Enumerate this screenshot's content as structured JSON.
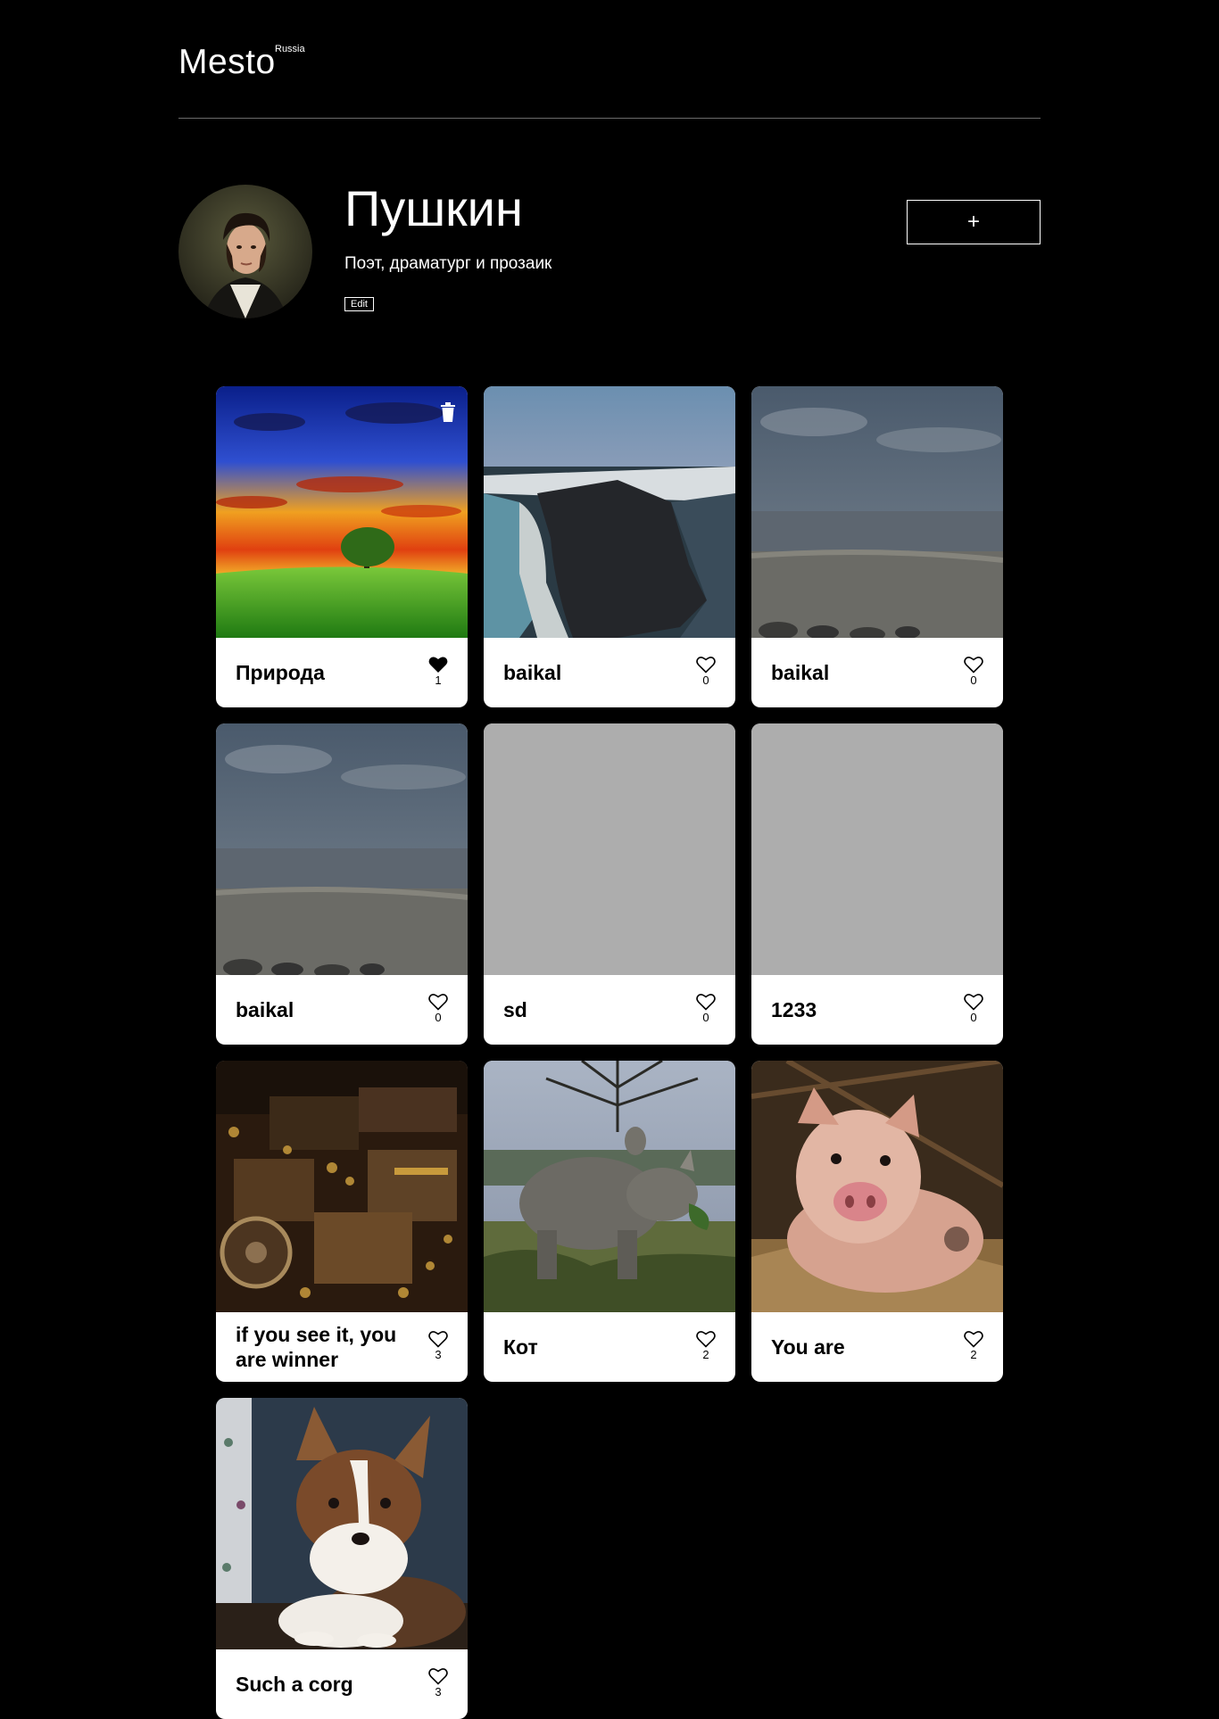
{
  "header": {
    "logo": "Mesto",
    "logo_sup": "Russia"
  },
  "profile": {
    "name": "Пушкин",
    "about": "Поэт, драматург и прозаик",
    "edit_label": "Edit",
    "add_label": "+"
  },
  "cards": [
    {
      "title": "Природа",
      "likes": "1",
      "liked": true,
      "deletable": true,
      "image": "sunset-tree"
    },
    {
      "title": "baikal",
      "likes": "0",
      "liked": false,
      "deletable": false,
      "image": "cliff-shore"
    },
    {
      "title": "baikal",
      "likes": "0",
      "liked": false,
      "deletable": false,
      "image": "grey-beach"
    },
    {
      "title": "baikal",
      "likes": "0",
      "liked": false,
      "deletable": false,
      "image": "grey-beach"
    },
    {
      "title": "sd",
      "likes": "0",
      "liked": false,
      "deletable": false,
      "image": "placeholder"
    },
    {
      "title": "1233",
      "likes": "0",
      "liked": false,
      "deletable": false,
      "image": "placeholder"
    },
    {
      "title": "if you see it, you are winner",
      "likes": "3",
      "liked": false,
      "deletable": false,
      "image": "treasure"
    },
    {
      "title": "Кот",
      "likes": "2",
      "liked": false,
      "deletable": false,
      "image": "rhino"
    },
    {
      "title": "You are",
      "likes": "2",
      "liked": false,
      "deletable": false,
      "image": "piglet"
    },
    {
      "title": "Such a corg",
      "likes": "3",
      "liked": false,
      "deletable": false,
      "image": "corgi"
    }
  ]
}
